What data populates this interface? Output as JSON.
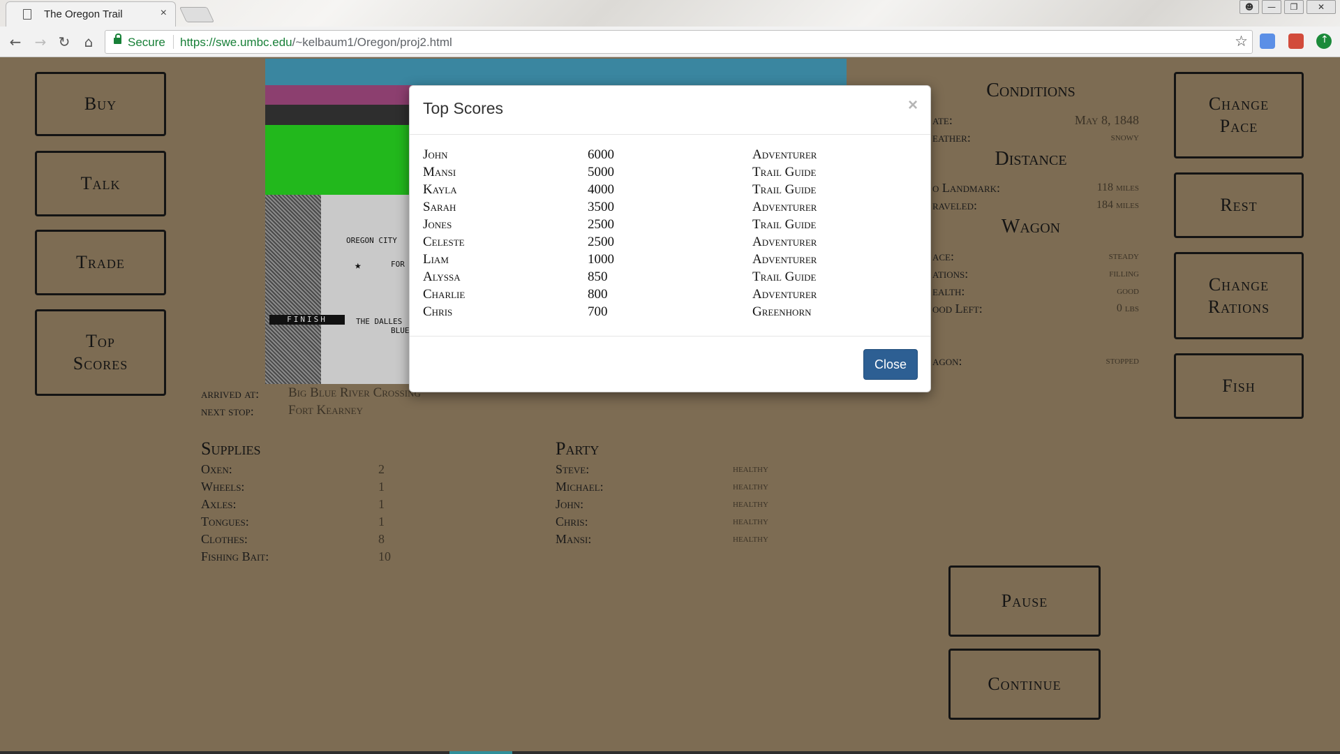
{
  "browser": {
    "tab_title": "The Oregon Trail",
    "tab_close": "×",
    "secure_label": "Secure",
    "url_host": "https://swe.umbc.edu",
    "url_path": "/~kelbaum1/Oregon/proj2.html",
    "icons": [
      "back-arrow-icon",
      "forward-arrow-icon",
      "reload-icon",
      "home-icon",
      "lock-icon",
      "star-icon"
    ]
  },
  "left_buttons": [
    "Buy",
    "Talk",
    "Trade",
    "Top Scores"
  ],
  "right_buttons": [
    "Change Pace",
    "Rest",
    "Change Rations",
    "Fish"
  ],
  "bottom_buttons": [
    "Pause",
    "Continue"
  ],
  "map_labels": {
    "finish": "FINISH",
    "oregon_city": "OREGON CITY",
    "the_dalles": "THE DALLES",
    "blue_mountains": "BLUE MOUNT",
    "fort": "FOR"
  },
  "location": {
    "arrived_label": "arrived at:",
    "arrived_value": "Big Blue River Crossing",
    "next_label": "next stop:",
    "next_value": "Fort Kearney"
  },
  "supplies": {
    "title": "Supplies",
    "items": [
      {
        "label": "Oxen:",
        "value": "2"
      },
      {
        "label": "Wheels:",
        "value": "1"
      },
      {
        "label": "Axles:",
        "value": "1"
      },
      {
        "label": "Tongues:",
        "value": "1"
      },
      {
        "label": "Clothes:",
        "value": "8"
      },
      {
        "label": "Fishing Bait:",
        "value": "10"
      }
    ]
  },
  "party": {
    "title": "Party",
    "members": [
      {
        "name": "Steve:",
        "status": "healthy"
      },
      {
        "name": "Michael:",
        "status": "healthy"
      },
      {
        "name": "John:",
        "status": "healthy"
      },
      {
        "name": "Chris:",
        "status": "healthy"
      },
      {
        "name": "Mansi:",
        "status": "healthy"
      }
    ]
  },
  "conditions": {
    "title": "Conditions",
    "date_label": "ate:",
    "date_value": "May 8, 1848",
    "weather_label": "eather:",
    "weather_value": "snowy",
    "distance_title": "Distance",
    "landmark_label": "o Landmark:",
    "landmark_value": "118 miles",
    "traveled_label": "raveled:",
    "traveled_value": "184 miles",
    "wagon_title": "Wagon",
    "pace_label": "ace:",
    "pace_value": "steady",
    "rations_label": "ations:",
    "rations_value": "filling",
    "health_label": "ealth:",
    "health_value": "good",
    "food_label": "ood Left:",
    "food_value": "0 lbs",
    "wagon_label": "agon:",
    "wagon_value": "stopped"
  },
  "modal": {
    "title": "Top Scores",
    "close_x": "×",
    "close_button": "Close",
    "scores": [
      {
        "name": "John",
        "score": "6000",
        "rank": "Adventurer"
      },
      {
        "name": "Mansi",
        "score": "5000",
        "rank": "Trail Guide"
      },
      {
        "name": "Kayla",
        "score": "4000",
        "rank": "Trail Guide"
      },
      {
        "name": "Sarah",
        "score": "3500",
        "rank": "Adventurer"
      },
      {
        "name": "Jones",
        "score": "2500",
        "rank": "Trail Guide"
      },
      {
        "name": "Celeste",
        "score": "2500",
        "rank": "Adventurer"
      },
      {
        "name": "Liam",
        "score": "1000",
        "rank": "Adventurer"
      },
      {
        "name": "Alyssa",
        "score": "850",
        "rank": "Trail Guide"
      },
      {
        "name": "Charlie",
        "score": "800",
        "rank": "Adventurer"
      },
      {
        "name": "Chris",
        "score": "700",
        "rank": "Greenhorn"
      }
    ]
  }
}
